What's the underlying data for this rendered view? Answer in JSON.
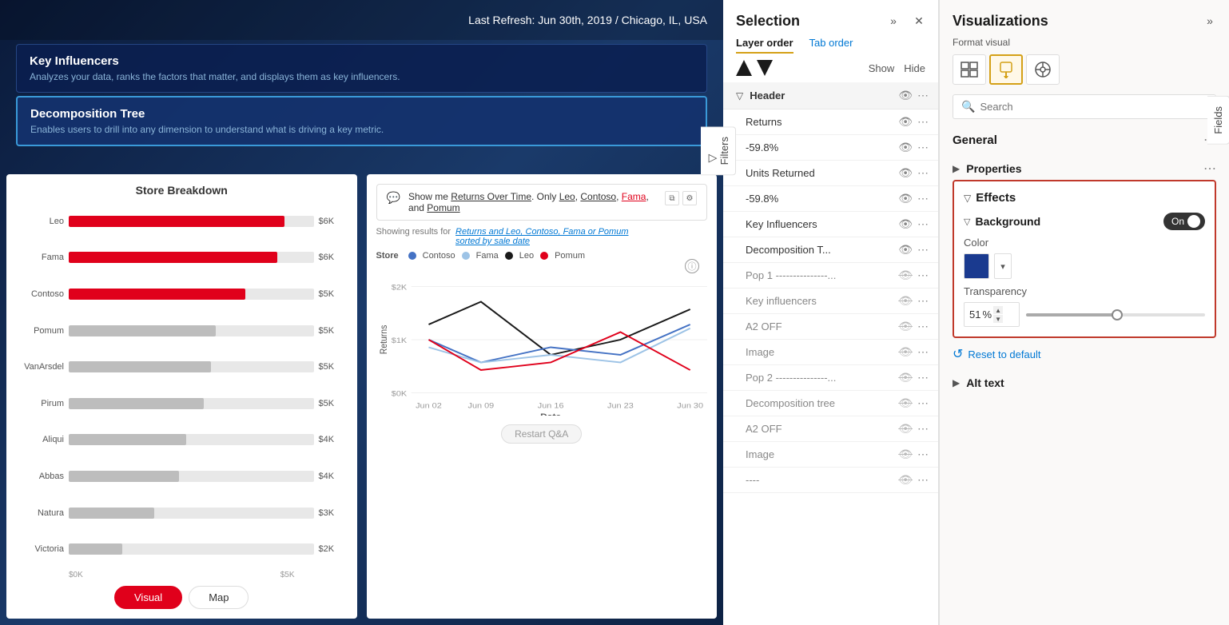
{
  "app": {
    "last_refresh": "Last Refresh: Jun 30th, 2019 / Chicago, IL, USA"
  },
  "main": {
    "visual_cards": [
      {
        "title": "Key Influencers",
        "description": "Analyzes your data, ranks the factors that matter, and displays them as key influencers."
      },
      {
        "title": "Decomposition Tree",
        "description": "Enables users to drill into any dimension to understand what is driving a key metric."
      }
    ],
    "store_breakdown": {
      "title": "Store Breakdown",
      "bars": [
        {
          "label": "Leo",
          "value": "$6K",
          "pct": 88,
          "color": "red"
        },
        {
          "label": "Fama",
          "value": "$6K",
          "pct": 85,
          "color": "red"
        },
        {
          "label": "Contoso",
          "value": "$5K",
          "pct": 72,
          "color": "red"
        },
        {
          "label": "Pomum",
          "value": "$5K",
          "pct": 60,
          "color": "gray"
        },
        {
          "label": "VanArsdel",
          "value": "$5K",
          "pct": 58,
          "color": "gray"
        },
        {
          "label": "Pirum",
          "value": "$5K",
          "pct": 55,
          "color": "gray"
        },
        {
          "label": "Aliqui",
          "value": "$4K",
          "pct": 48,
          "color": "gray"
        },
        {
          "label": "Abbas",
          "value": "$4K",
          "pct": 45,
          "color": "gray"
        },
        {
          "label": "Natura",
          "value": "$3K",
          "pct": 35,
          "color": "gray"
        },
        {
          "label": "Victoria",
          "value": "$2K",
          "pct": 22,
          "color": "gray"
        }
      ],
      "axis_labels": [
        "$0K",
        "$5K"
      ],
      "tabs": [
        "Visual",
        "Map"
      ],
      "active_tab": "Visual"
    },
    "qa": {
      "input_text": "Show me Returns Over Time. Only Leo, Contoso, Fama, and Pomum",
      "showing_label": "Showing results for",
      "showing_link": "Returns and Leo, Contoso, Fama or Pomum sorted by sale date",
      "legend_store": "Store",
      "legend_items": [
        {
          "label": "Contoso",
          "color": "#4472c4"
        },
        {
          "label": "Fama",
          "color": "#9dc3e6"
        },
        {
          "label": "Leo",
          "color": "#1a1a1a"
        },
        {
          "label": "Pomum",
          "color": "#e0001b"
        }
      ],
      "y_label": "Returns",
      "x_label": "Date",
      "x_ticks": [
        "Jun 02",
        "Jun 09",
        "Jun 16",
        "Jun 23",
        "Jun 30"
      ],
      "y_ticks": [
        "$2K",
        "$1K",
        "$0K"
      ],
      "restart_btn": "Restart Q&A"
    }
  },
  "selection": {
    "title": "Selection",
    "tabs": [
      {
        "label": "Layer order",
        "active": true
      },
      {
        "label": "Tab order",
        "active": false
      }
    ],
    "show_label": "Show",
    "hide_label": "Hide",
    "group_header": "Header",
    "items": [
      {
        "label": "Returns",
        "visible": true
      },
      {
        "label": "-59.8%",
        "visible": true
      },
      {
        "label": "Units Returned",
        "visible": true
      },
      {
        "label": "-59.8%",
        "visible": true
      },
      {
        "label": "Key Influencers",
        "visible": true
      },
      {
        "label": "Decomposition T...",
        "visible": true
      },
      {
        "label": "Pop 1 ---------------...",
        "visible": false
      },
      {
        "label": "Key influencers",
        "visible": false
      },
      {
        "label": "A2 OFF",
        "visible": false
      },
      {
        "label": "Image",
        "visible": false
      },
      {
        "label": "Pop 2 ---------------...",
        "visible": false
      },
      {
        "label": "Decomposition tree",
        "visible": false
      },
      {
        "label": "A2 OFF",
        "visible": false
      },
      {
        "label": "Image",
        "visible": false
      },
      {
        "label": "----",
        "visible": false
      }
    ],
    "filters_label": "Filters"
  },
  "visualizations": {
    "title": "Visualizations",
    "expand_label": ">>",
    "format_visual_label": "Format visual",
    "icons": [
      "grid-icon",
      "paint-icon",
      "analytics-icon"
    ],
    "search_placeholder": "Search",
    "general_label": "General",
    "properties_label": "Properties",
    "effects_label": "Effects",
    "background_label": "Background",
    "toggle_on_label": "On",
    "color_label": "Color",
    "transparency_label": "Transparency",
    "transparency_value": "51",
    "transparency_pct": "%",
    "reset_label": "Reset to default",
    "alt_text_label": "Alt text",
    "fields_label": "Fields"
  }
}
